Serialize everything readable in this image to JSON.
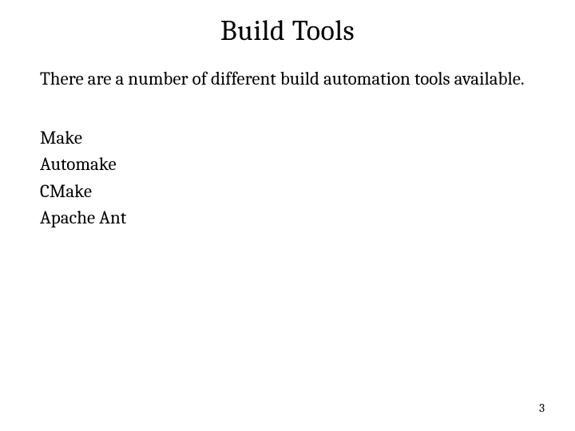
{
  "title": "Build Tools",
  "intro": "There are a number of different build automation tools available.",
  "tools": {
    "0": "Make",
    "1": "Automake",
    "2": "CMake",
    "3": "Apache Ant"
  },
  "page_number": "3"
}
